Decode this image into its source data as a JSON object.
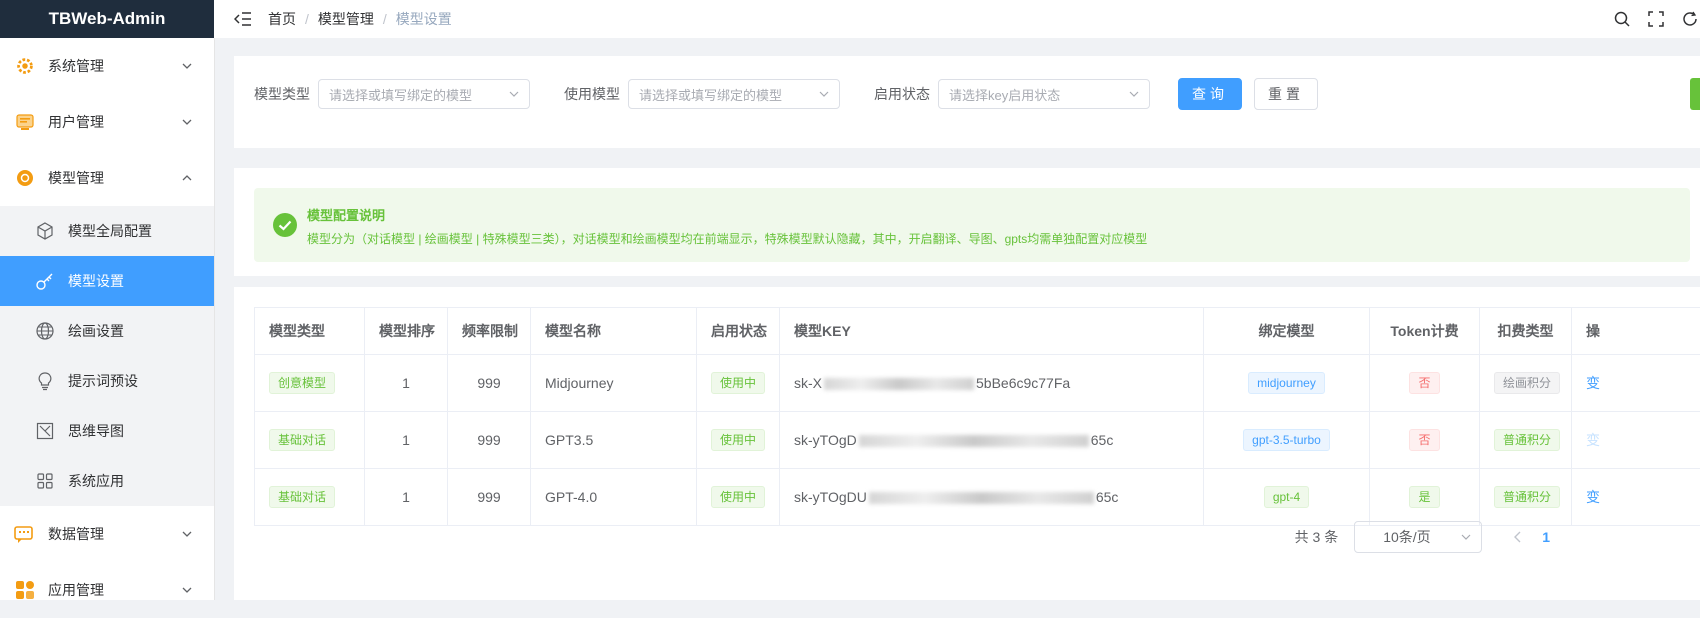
{
  "app": {
    "title": "TBWeb-Admin"
  },
  "sidebar": {
    "menus": [
      {
        "label": "系统管理",
        "icon": "gear-icon"
      },
      {
        "label": "用户管理",
        "icon": "user-card-icon"
      },
      {
        "label": "模型管理",
        "icon": "model-icon"
      }
    ],
    "submenu": [
      {
        "label": "模型全局配置",
        "icon": "cube-icon"
      },
      {
        "label": "模型设置",
        "icon": "key-icon"
      },
      {
        "label": "绘画设置",
        "icon": "globe-icon"
      },
      {
        "label": "提示词预设",
        "icon": "bulb-icon"
      },
      {
        "label": "思维导图",
        "icon": "mindmap-icon"
      },
      {
        "label": "系统应用",
        "icon": "apps-icon"
      }
    ],
    "menus_after": [
      {
        "label": "数据管理",
        "icon": "chat-data-icon"
      },
      {
        "label": "应用管理",
        "icon": "app-grid-icon"
      }
    ]
  },
  "breadcrumb": [
    "首页",
    "模型管理",
    "模型设置"
  ],
  "filters": {
    "model_type": {
      "label": "模型类型",
      "placeholder": "请选择或填写绑定的模型"
    },
    "use_model": {
      "label": "使用模型",
      "placeholder": "请选择或填写绑定的模型"
    },
    "status": {
      "label": "启用状态",
      "placeholder": "请选择key启用状态"
    },
    "search_label": "查询",
    "reset_label": "重置"
  },
  "alert": {
    "title": "模型配置说明",
    "description": "模型分为（对话模型 | 绘画模型 | 特殊模型三类），对话模型和绘画模型均在前端显示，特殊模型默认隐藏，其中，开启翻译、导图、gpts均需单独配置对应模型"
  },
  "table": {
    "headers": [
      "模型类型",
      "模型排序",
      "频率限制",
      "模型名称",
      "启用状态",
      "模型KEY",
      "绑定模型",
      "Token计费",
      "扣费类型",
      "操"
    ],
    "rows": [
      {
        "type": "创意模型",
        "order": "1",
        "limit": "999",
        "name": "Midjourney",
        "status": "使用中",
        "key_prefix": "sk-X",
        "key_suffix": "5bBe6c9c77Fa",
        "bound": "midjourney",
        "bound_color": "blue",
        "token": "否",
        "token_color": "red",
        "charge": "绘画积分",
        "charge_color": "gray",
        "op": "变"
      },
      {
        "type": "基础对话",
        "order": "1",
        "limit": "999",
        "name": "GPT3.5",
        "status": "使用中",
        "key_prefix": "sk-yTOgD",
        "key_suffix": "65c",
        "bound": "gpt-3.5-turbo",
        "bound_color": "blue",
        "token": "否",
        "token_color": "red",
        "charge": "普通积分",
        "charge_color": "green",
        "op": "变"
      },
      {
        "type": "基础对话",
        "order": "1",
        "limit": "999",
        "name": "GPT-4.0",
        "status": "使用中",
        "key_prefix": "sk-yTOgDU",
        "key_suffix": "65c",
        "bound": "gpt-4",
        "bound_color": "green",
        "token": "是",
        "token_color": "green",
        "charge": "普通积分",
        "charge_color": "green",
        "op": "变"
      }
    ]
  },
  "pagination": {
    "total": "共 3 条",
    "page_size": "10条/页",
    "current_page": "1"
  },
  "colors": {
    "primary": "#409eff",
    "success": "#67c23a",
    "danger": "#f56c6c",
    "sidebar_logo_bg": "#1f2d3d"
  }
}
